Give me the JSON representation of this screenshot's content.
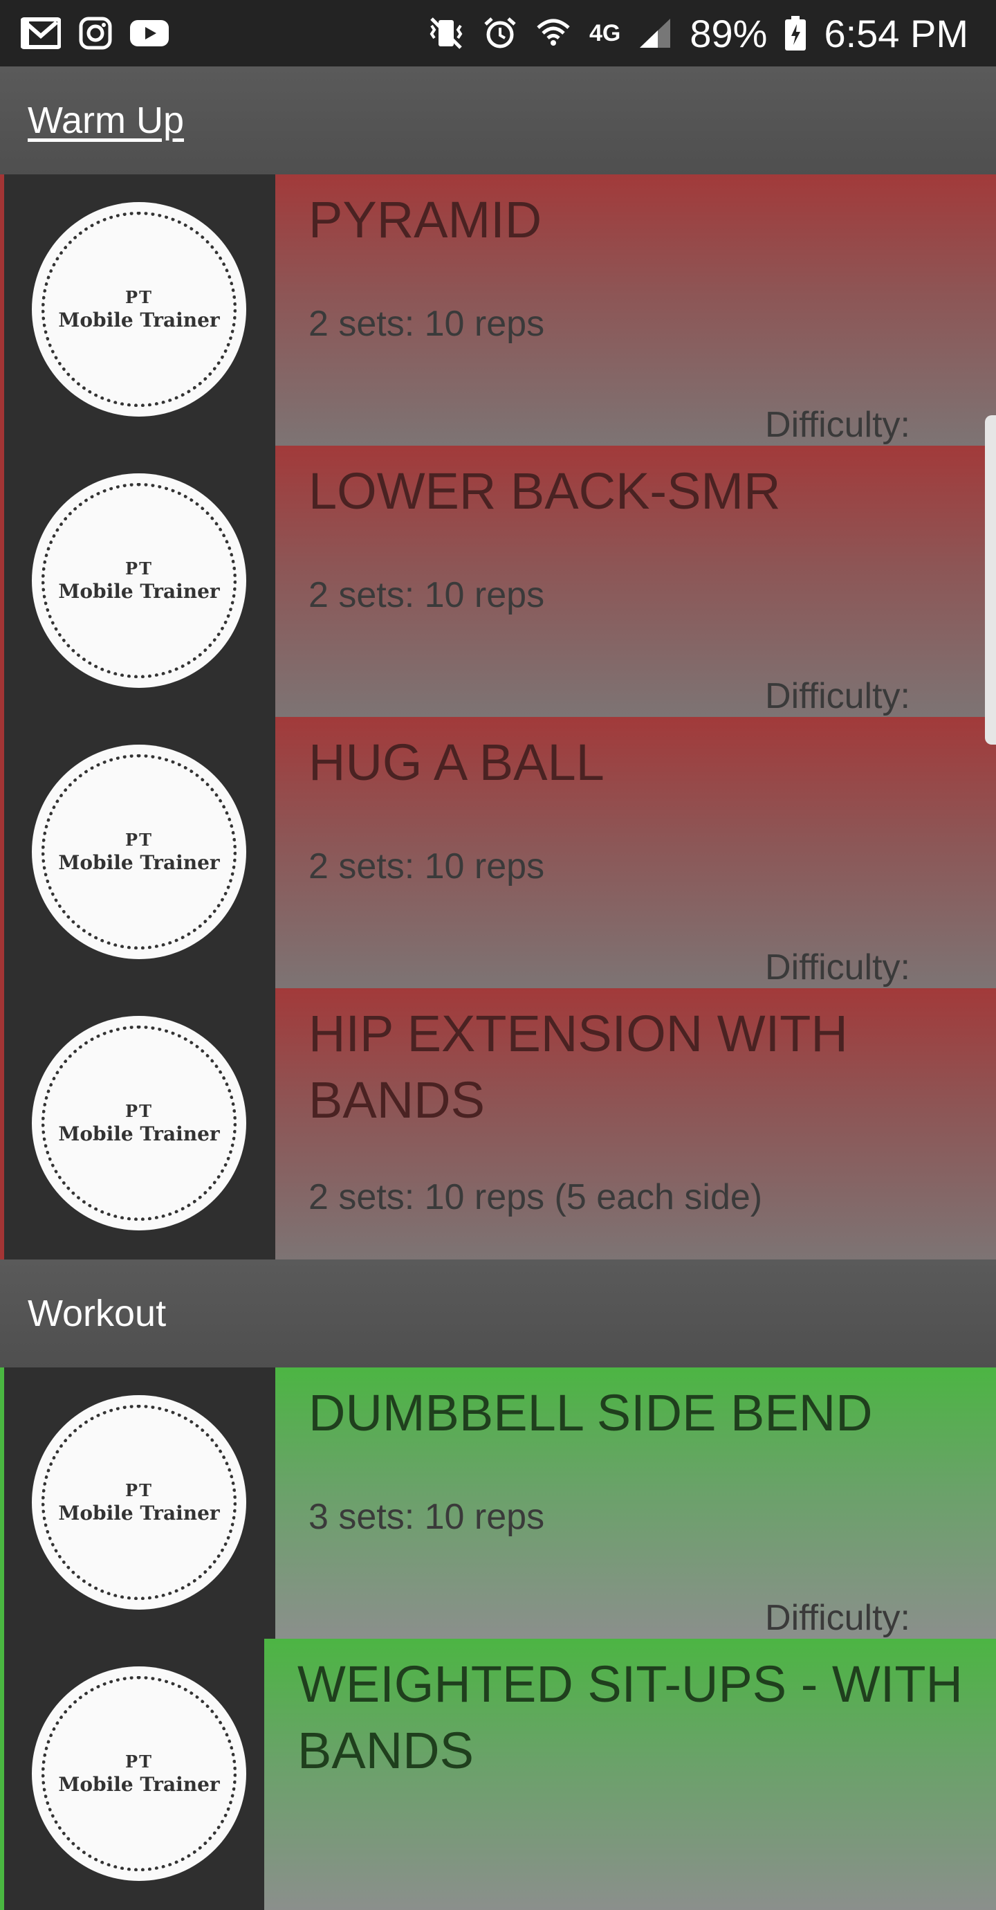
{
  "status_bar": {
    "battery": "89%",
    "time": "6:54 PM",
    "network": "4G",
    "left_icons": [
      "gmail-icon",
      "instagram-icon",
      "youtube-icon"
    ],
    "right_icons": [
      "vibrate-icon",
      "alarm-icon",
      "wifi-icon",
      "lte-icon",
      "signal-icon",
      "battery-icon"
    ]
  },
  "logo": {
    "line1": "PT",
    "line2": "Mobile Trainer"
  },
  "sections": [
    {
      "title": "Warm Up",
      "color": "#a23a3a",
      "items": [
        {
          "name": "PYRAMID",
          "sets": "2 sets: 10 reps",
          "difficulty": "Difficulty:"
        },
        {
          "name": "LOWER BACK-SMR",
          "sets": "2 sets: 10 reps",
          "difficulty": "Difficulty:"
        },
        {
          "name": "HUG A BALL",
          "sets": "2 sets: 10 reps",
          "difficulty": "Difficulty:"
        },
        {
          "name": "HIP EXTENSION WITH BANDS",
          "sets": "2 sets: 10 reps (5 each side)",
          "difficulty": ""
        }
      ]
    },
    {
      "title": "Workout",
      "color": "#4cb543",
      "items": [
        {
          "name": "DUMBBELL SIDE BEND",
          "sets": "3 sets: 10 reps",
          "difficulty": "Difficulty:"
        },
        {
          "name": "WEIGHTED SIT-UPS - WITH BANDS",
          "sets": "",
          "difficulty": ""
        }
      ]
    }
  ]
}
